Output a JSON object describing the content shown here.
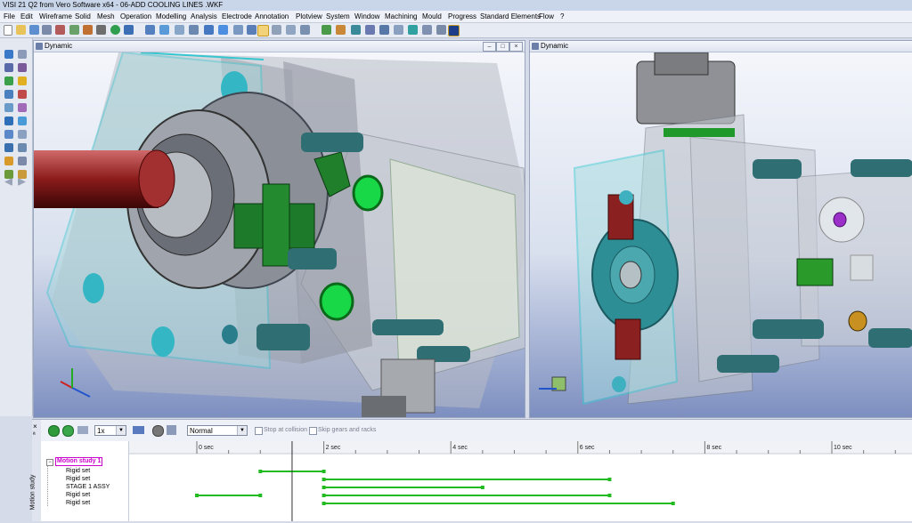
{
  "window": {
    "title": "VISI 21 Q2 from Vero Software x64 - 06-ADD COOLING LINES .WKF"
  },
  "menu": [
    "File",
    "Edit",
    "Wireframe",
    "Solid",
    "Mesh",
    "Operation",
    "Modelling",
    "Analysis",
    "Electrode",
    "Annotation",
    "Plotview",
    "System",
    "Window",
    "Machining",
    "Mould",
    "Progress",
    "Standard Elements",
    "Flow",
    "?"
  ],
  "viewports": [
    {
      "title": "Dynamic",
      "buttons": [
        "–",
        "□",
        "×"
      ]
    },
    {
      "title": "Dynamic"
    }
  ],
  "motion": {
    "panel_label": "Motion study",
    "speed": "1x",
    "mode": "Normal",
    "stop_at_collision": "Stop at collision",
    "skip_gears": "Skip gears and racks",
    "tree": {
      "root": "Motion study 1",
      "items": [
        "Rigid set",
        "Rigid set",
        "STAGE 1 ASSY",
        "Rigid set",
        "Rigid set"
      ]
    },
    "ticks": [
      "0 sec",
      "2 sec",
      "4 sec",
      "6 sec",
      "8 sec",
      "10 sec"
    ],
    "tracks": [
      {
        "start": 1.0,
        "end": 2.0
      },
      {
        "start": 2.0,
        "end": 6.5
      },
      {
        "start": 2.0,
        "end": 4.5
      },
      {
        "start": 0.0,
        "end": 1.0,
        "start2": 2.0,
        "end2": 6.5
      },
      {
        "start": 2.0,
        "end": 7.5
      }
    ],
    "cursor_sec": 1.5
  },
  "colors": {
    "track": "#22bb22",
    "root_text": "#cc00cc",
    "cyan": "#58d8d8"
  }
}
